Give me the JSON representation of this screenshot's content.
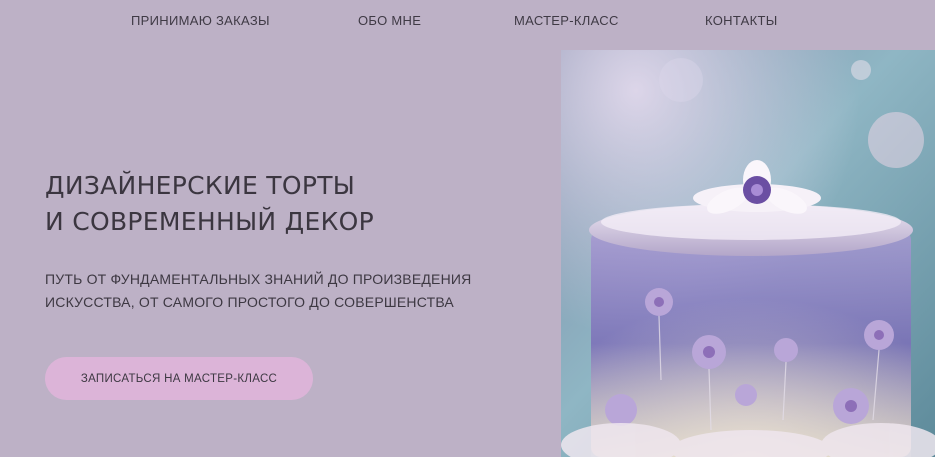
{
  "nav": {
    "items": [
      {
        "label": "ПРИНИМАЮ ЗАКАЗЫ"
      },
      {
        "label": "ОБО МНЕ"
      },
      {
        "label": "МАСТЕР-КЛАСС"
      },
      {
        "label": "КОНТАКТЫ"
      }
    ]
  },
  "hero": {
    "title_line1": "ДИЗАЙНЕРСКИЕ ТОРТЫ",
    "title_line2": "И СОВРЕМЕННЫЙ ДЕКОР",
    "subtitle_line1": "ПУТЬ ОТ ФУНДАМЕНТАЛЬНЫХ ЗНАНИЙ ДО ПРОИЗВЕДЕНИЯ",
    "subtitle_line2": "ИСКУССТВА, ОТ  САМОГО ПРОСТОГО ДО СОВЕРШЕНСТВА",
    "cta_label": "ЗАПИСАТЬСЯ НА МАСТЕР-КЛАСС"
  },
  "colors": {
    "background": "#bdb1c6",
    "button": "#dcb4d8",
    "text": "#3d3842"
  }
}
